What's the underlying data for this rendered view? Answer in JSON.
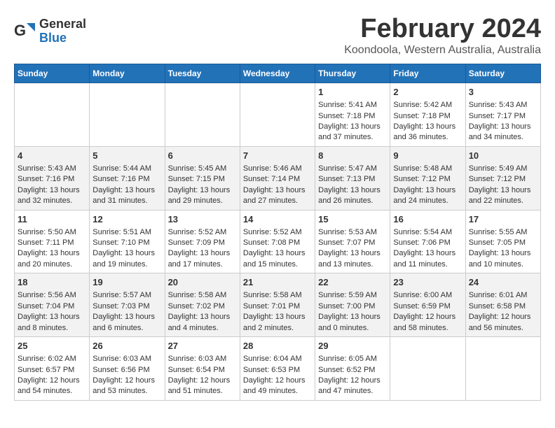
{
  "logo": {
    "general": "General",
    "blue": "Blue"
  },
  "header": {
    "month": "February 2024",
    "location": "Koondoola, Western Australia, Australia"
  },
  "weekdays": [
    "Sunday",
    "Monday",
    "Tuesday",
    "Wednesday",
    "Thursday",
    "Friday",
    "Saturday"
  ],
  "weeks": [
    [
      {
        "day": "",
        "content": ""
      },
      {
        "day": "",
        "content": ""
      },
      {
        "day": "",
        "content": ""
      },
      {
        "day": "",
        "content": ""
      },
      {
        "day": "1",
        "content": "Sunrise: 5:41 AM\nSunset: 7:18 PM\nDaylight: 13 hours\nand 37 minutes."
      },
      {
        "day": "2",
        "content": "Sunrise: 5:42 AM\nSunset: 7:18 PM\nDaylight: 13 hours\nand 36 minutes."
      },
      {
        "day": "3",
        "content": "Sunrise: 5:43 AM\nSunset: 7:17 PM\nDaylight: 13 hours\nand 34 minutes."
      }
    ],
    [
      {
        "day": "4",
        "content": "Sunrise: 5:43 AM\nSunset: 7:16 PM\nDaylight: 13 hours\nand 32 minutes."
      },
      {
        "day": "5",
        "content": "Sunrise: 5:44 AM\nSunset: 7:16 PM\nDaylight: 13 hours\nand 31 minutes."
      },
      {
        "day": "6",
        "content": "Sunrise: 5:45 AM\nSunset: 7:15 PM\nDaylight: 13 hours\nand 29 minutes."
      },
      {
        "day": "7",
        "content": "Sunrise: 5:46 AM\nSunset: 7:14 PM\nDaylight: 13 hours\nand 27 minutes."
      },
      {
        "day": "8",
        "content": "Sunrise: 5:47 AM\nSunset: 7:13 PM\nDaylight: 13 hours\nand 26 minutes."
      },
      {
        "day": "9",
        "content": "Sunrise: 5:48 AM\nSunset: 7:12 PM\nDaylight: 13 hours\nand 24 minutes."
      },
      {
        "day": "10",
        "content": "Sunrise: 5:49 AM\nSunset: 7:12 PM\nDaylight: 13 hours\nand 22 minutes."
      }
    ],
    [
      {
        "day": "11",
        "content": "Sunrise: 5:50 AM\nSunset: 7:11 PM\nDaylight: 13 hours\nand 20 minutes."
      },
      {
        "day": "12",
        "content": "Sunrise: 5:51 AM\nSunset: 7:10 PM\nDaylight: 13 hours\nand 19 minutes."
      },
      {
        "day": "13",
        "content": "Sunrise: 5:52 AM\nSunset: 7:09 PM\nDaylight: 13 hours\nand 17 minutes."
      },
      {
        "day": "14",
        "content": "Sunrise: 5:52 AM\nSunset: 7:08 PM\nDaylight: 13 hours\nand 15 minutes."
      },
      {
        "day": "15",
        "content": "Sunrise: 5:53 AM\nSunset: 7:07 PM\nDaylight: 13 hours\nand 13 minutes."
      },
      {
        "day": "16",
        "content": "Sunrise: 5:54 AM\nSunset: 7:06 PM\nDaylight: 13 hours\nand 11 minutes."
      },
      {
        "day": "17",
        "content": "Sunrise: 5:55 AM\nSunset: 7:05 PM\nDaylight: 13 hours\nand 10 minutes."
      }
    ],
    [
      {
        "day": "18",
        "content": "Sunrise: 5:56 AM\nSunset: 7:04 PM\nDaylight: 13 hours\nand 8 minutes."
      },
      {
        "day": "19",
        "content": "Sunrise: 5:57 AM\nSunset: 7:03 PM\nDaylight: 13 hours\nand 6 minutes."
      },
      {
        "day": "20",
        "content": "Sunrise: 5:58 AM\nSunset: 7:02 PM\nDaylight: 13 hours\nand 4 minutes."
      },
      {
        "day": "21",
        "content": "Sunrise: 5:58 AM\nSunset: 7:01 PM\nDaylight: 13 hours\nand 2 minutes."
      },
      {
        "day": "22",
        "content": "Sunrise: 5:59 AM\nSunset: 7:00 PM\nDaylight: 13 hours\nand 0 minutes."
      },
      {
        "day": "23",
        "content": "Sunrise: 6:00 AM\nSunset: 6:59 PM\nDaylight: 12 hours\nand 58 minutes."
      },
      {
        "day": "24",
        "content": "Sunrise: 6:01 AM\nSunset: 6:58 PM\nDaylight: 12 hours\nand 56 minutes."
      }
    ],
    [
      {
        "day": "25",
        "content": "Sunrise: 6:02 AM\nSunset: 6:57 PM\nDaylight: 12 hours\nand 54 minutes."
      },
      {
        "day": "26",
        "content": "Sunrise: 6:03 AM\nSunset: 6:56 PM\nDaylight: 12 hours\nand 53 minutes."
      },
      {
        "day": "27",
        "content": "Sunrise: 6:03 AM\nSunset: 6:54 PM\nDaylight: 12 hours\nand 51 minutes."
      },
      {
        "day": "28",
        "content": "Sunrise: 6:04 AM\nSunset: 6:53 PM\nDaylight: 12 hours\nand 49 minutes."
      },
      {
        "day": "29",
        "content": "Sunrise: 6:05 AM\nSunset: 6:52 PM\nDaylight: 12 hours\nand 47 minutes."
      },
      {
        "day": "",
        "content": ""
      },
      {
        "day": "",
        "content": ""
      }
    ]
  ]
}
